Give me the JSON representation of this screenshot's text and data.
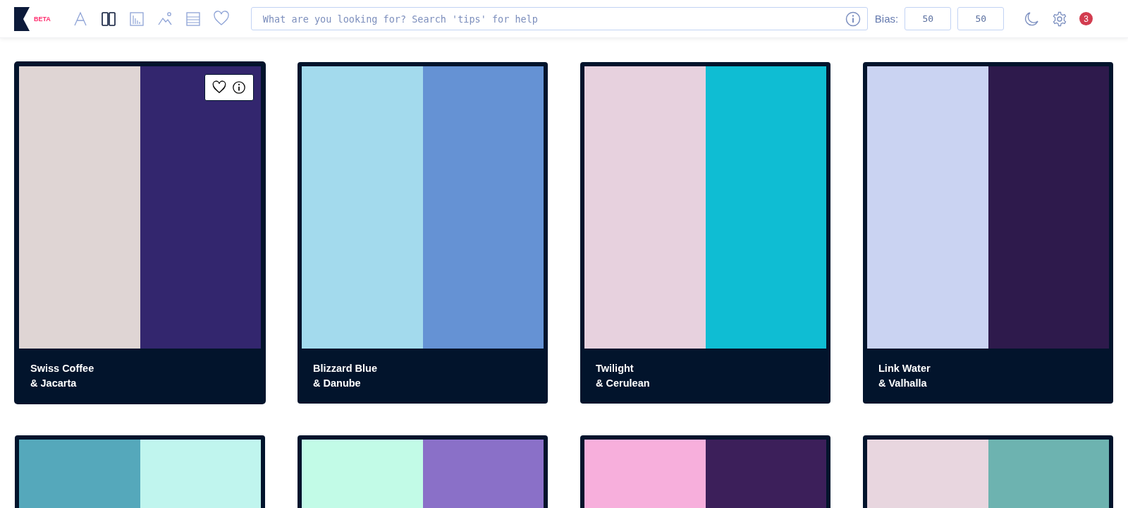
{
  "header": {
    "logo_badge": "BETA",
    "nav": [
      {
        "kind": "font",
        "selected": false
      },
      {
        "kind": "columns",
        "selected": true
      },
      {
        "kind": "chart",
        "selected": false
      },
      {
        "kind": "image",
        "selected": false
      },
      {
        "kind": "rows",
        "selected": false
      },
      {
        "kind": "heart",
        "selected": false
      }
    ],
    "search": {
      "placeholder": "What are you looking for? Search 'tips' for help"
    },
    "bias_label": "Bias:",
    "bias_values": [
      "50",
      "50"
    ],
    "notification_count": "3"
  },
  "palettes": [
    {
      "swatches": [
        {
          "color": "#dfd5d4"
        },
        {
          "color": "#33266e"
        }
      ],
      "name_lines": [
        "Swiss Coffee",
        "& Jacarta"
      ],
      "hovered": true
    },
    {
      "swatches": [
        {
          "color": "#a3daed"
        },
        {
          "color": "#6592d4"
        }
      ],
      "name_lines": [
        "Blizzard Blue",
        "& Danube"
      ],
      "hovered": false
    },
    {
      "swatches": [
        {
          "color": "#e7d1de"
        },
        {
          "color": "#0fbdd3"
        }
      ],
      "name_lines": [
        "Twilight",
        "& Cerulean"
      ],
      "hovered": false
    },
    {
      "swatches": [
        {
          "color": "#cad3f2"
        },
        {
          "color": "#2e1a4c"
        }
      ],
      "name_lines": [
        "Link Water",
        "& Valhalla"
      ],
      "hovered": false
    },
    {
      "swatches": [
        {
          "color": "#55a8bb"
        },
        {
          "color": "#c0f5ee"
        }
      ],
      "hovered": false
    },
    {
      "swatches": [
        {
          "color": "#c2fbe7"
        },
        {
          "color": "#8a70c8"
        }
      ],
      "hovered": false
    },
    {
      "swatches": [
        {
          "color": "#f7afdc"
        },
        {
          "color": "#3c1f5a"
        }
      ],
      "hovered": false
    },
    {
      "swatches": [
        {
          "color": "#e8d6df"
        },
        {
          "color": "#6db3b0"
        }
      ],
      "hovered": false
    }
  ]
}
